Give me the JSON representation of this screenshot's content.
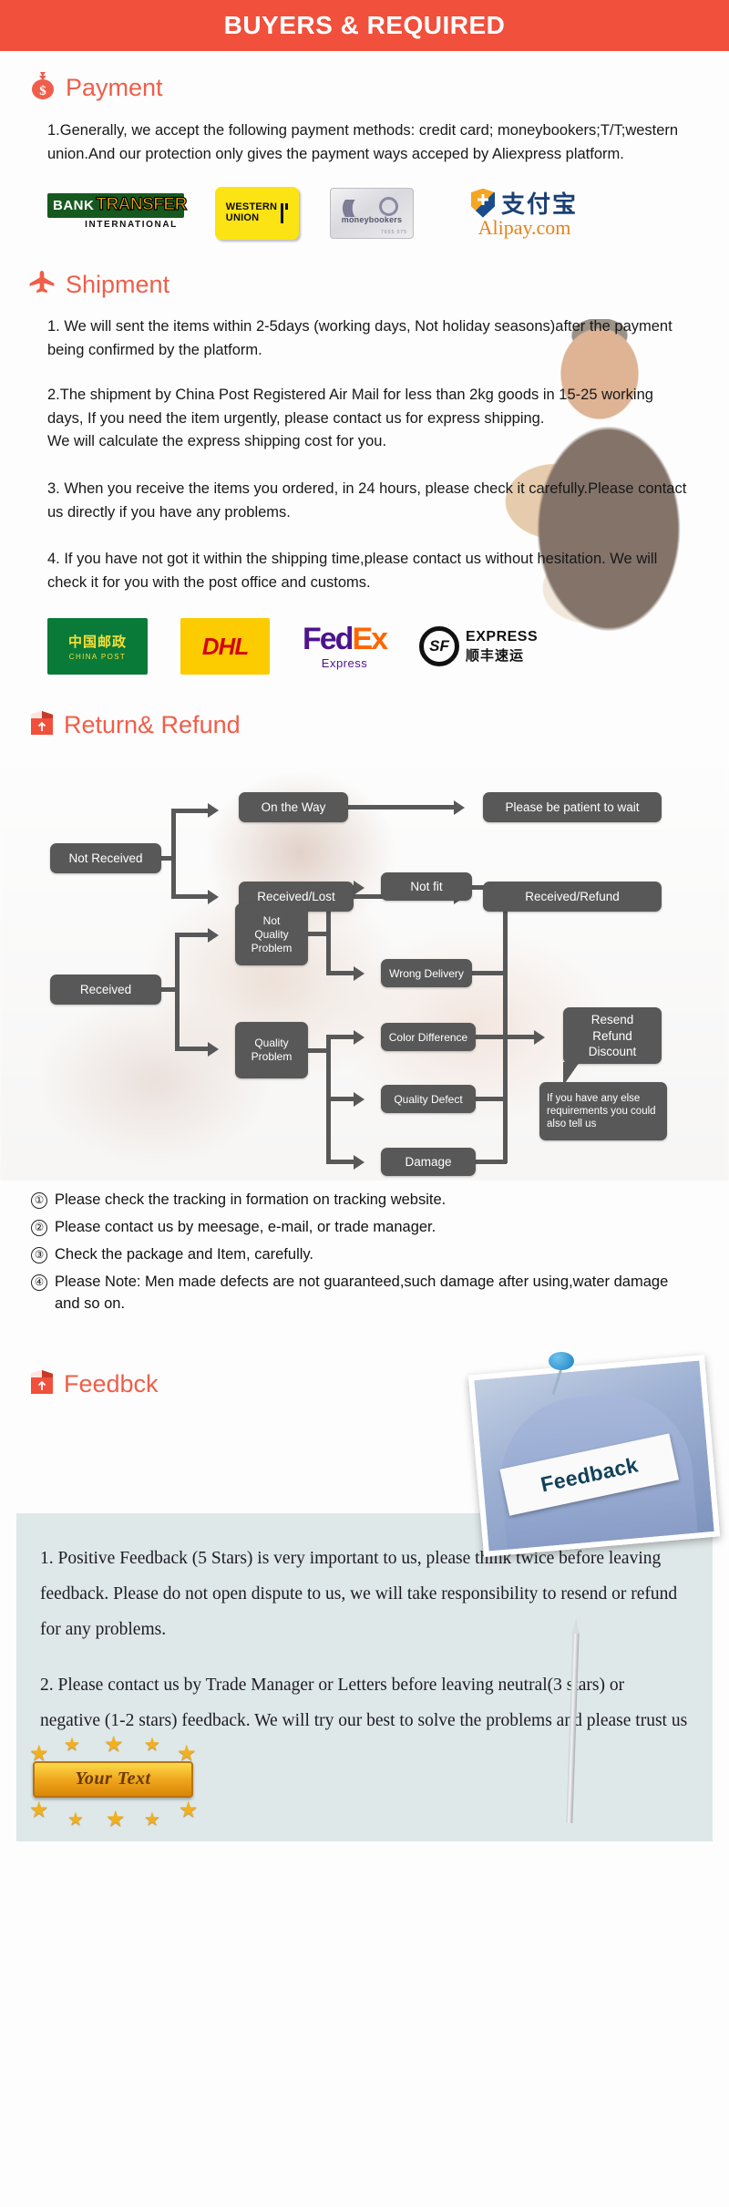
{
  "banner": {
    "title": "BUYERS & REQUIRED"
  },
  "payment": {
    "heading": "Payment",
    "icon": "money-bag-icon",
    "paragraph": "1.Generally, we accept the following payment methods: credit card; moneybookers;T/T;western union.And our protection only gives the payment ways acceped by Aliexpress platform.",
    "logos": [
      {
        "name": "bank-transfer-logo",
        "line1": "BANK",
        "line2": "TRANSFER",
        "line3": "INTERNATIONAL"
      },
      {
        "name": "western-union-logo",
        "line1": "WESTERN",
        "line2": "UNION"
      },
      {
        "name": "moneybookers-logo",
        "line1": "moneybookers",
        "line2": "7655 075"
      },
      {
        "name": "alipay-logo",
        "line1": "支付宝",
        "line2": "Alipay.com"
      }
    ]
  },
  "shipment": {
    "heading": "Shipment",
    "icon": "airplane-icon",
    "paragraphs": [
      "1. We will sent the items within 2-5days (working days, Not holiday seasons)after the payment being confirmed by the platform.",
      "2.The shipment by China Post Registered Air Mail for less than  2kg goods in 15-25 working days, If  you need the item urgently, please contact us for express shipping.\nWe will calculate the express shipping cost for you.",
      "3. When you receive the items you ordered, in 24 hours, please check  it carefully.Please contact us directly if you have any problems.",
      "4. If you have not got it within the shipping time,please contact us without hesitation. We will check it for you with the post office and customs."
    ],
    "couriers": [
      {
        "name": "china-post-logo",
        "cn": "中国邮政",
        "en": "CHINA POST"
      },
      {
        "name": "dhl-logo",
        "text": "DHL"
      },
      {
        "name": "fedex-logo",
        "fed": "Fed",
        "ex": "Ex",
        "sub": "Express"
      },
      {
        "name": "sf-express-logo",
        "badge": "SF",
        "en": "EXPRESS",
        "cn": "顺丰速运"
      }
    ]
  },
  "return_refund": {
    "heading": "Return& Refund",
    "icon": "return-box-icon",
    "flow_nodes": {
      "not_received": "Not Received",
      "on_the_way": "On the Way",
      "patient": "Please be patient to wait",
      "received_lost": "Received/Lost",
      "received_refund": "Received/Refund",
      "received": "Received",
      "not_quality_problem": "Not\nQuality\nProblem",
      "quality_problem": "Quality\nProblem",
      "not_fit": "Not fit",
      "wrong_delivery": "Wrong Delivery",
      "color_difference": "Color Difference",
      "quality_defect": "Quality Defect",
      "damage": "Damage",
      "resend": "Resend\nRefund\nDiscount",
      "tip": "If you have any else requirements you could also tell us"
    },
    "notes": [
      {
        "marker": "①",
        "text": "Please check the tracking in formation on tracking website."
      },
      {
        "marker": "②",
        "text": "Please contact us by meesage, e-mail, or trade manager."
      },
      {
        "marker": "③",
        "text": "Check the package and Item, carefully."
      },
      {
        "marker": "④",
        "text": "Please Note: Men made defects  are not guaranteed,such damage after using,water damage and so on."
      }
    ]
  },
  "feedback": {
    "heading": "Feedbck",
    "icon": "feedback-box-icon",
    "photo_caption": "Feedback",
    "paragraphs": [
      "1. Positive Feedback (5 Stars) is very important to us, please think twice before leaving feedback. Please do not open dispute to us,   we will take responsibility to resend or refund for any problems.",
      "2. Please contact us by Trade Manager or Letters before leaving neutral(3 stars) or negative (1-2 stars) feedback. We will try our best to solve the problems and please trust us"
    ],
    "stamp_text": "Your Text"
  },
  "colors": {
    "banner_bg": "#f0503c",
    "heading_text": "#ef5e4a",
    "node_bg": "#585858",
    "feedback_panel": "#dfe8e8"
  }
}
